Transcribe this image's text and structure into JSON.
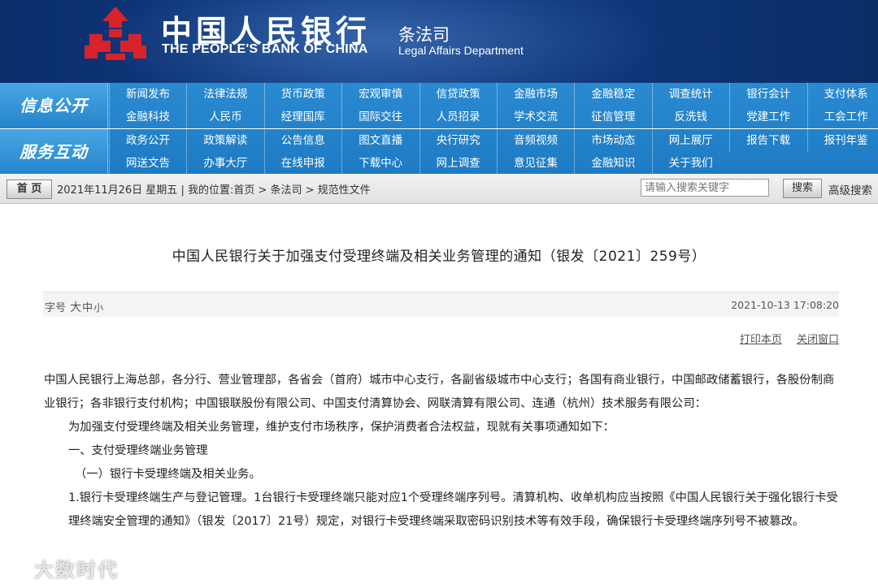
{
  "header": {
    "bank_name_cn": "中国人民银行",
    "bank_name_en": "THE PEOPLE'S BANK OF CHINA",
    "dept_cn": "条法司",
    "dept_en": "Legal Affairs Department"
  },
  "nav": {
    "groups": [
      {
        "title": "信息公开",
        "items": [
          "新闻发布",
          "法律法规",
          "货币政策",
          "宏观审慎",
          "信贷政策",
          "金融市场",
          "金融稳定",
          "调查统计",
          "银行会计",
          "支付体系",
          "金融科技",
          "人民币",
          "经理国库",
          "国际交往",
          "人员招录",
          "学术交流",
          "征信管理",
          "反洗钱",
          "党建工作",
          "工会工作"
        ]
      },
      {
        "title": "服务互动",
        "items": [
          "政务公开",
          "政策解读",
          "公告信息",
          "图文直播",
          "央行研究",
          "音频视频",
          "市场动态",
          "网上展厅",
          "报告下载",
          "报刊年鉴",
          "网送文告",
          "办事大厅",
          "在线申报",
          "下载中心",
          "网上调查",
          "意见征集",
          "金融知识",
          "关于我们"
        ]
      }
    ]
  },
  "toolbar": {
    "home": "首 页",
    "date": "2021年11月26日 星期五",
    "location_prefix": "| 我的位置:",
    "breadcrumb": "首页 > 条法司 > 规范性文件",
    "search_placeholder": "请输入搜索关键字",
    "search_button": "搜索",
    "advanced_search": "高级搜索"
  },
  "article": {
    "title": "中国人民银行关于加强支付受理终端及相关业务管理的通知（银发〔2021〕259号）",
    "font_size_label": "字号",
    "font_sizes": [
      "大",
      "中",
      "小"
    ],
    "timestamp": "2021-10-13 17:08:20",
    "print": "打印本页",
    "close": "关闭窗口",
    "paragraphs": [
      "中国人民银行上海总部，各分行、营业管理部，各省会（首府）城市中心支行，各副省级城市中心支行；各国有商业银行，中国邮政储蓄银行，各股份制商业银行；各非银行支付机构；中国银联股份有限公司、中国支付清算协会、网联清算有限公司、连通（杭州）技术服务有限公司：",
      "为加强支付受理终端及相关业务管理，维护支付市场秩序，保护消费者合法权益，现就有关事项通知如下：",
      "一、支付受理终端业务管理",
      "（一）银行卡受理终端及相关业务。",
      "1.银行卡受理终端生产与登记管理。1台银行卡受理终端只能对应1个受理终端序列号。清算机构、收单机构应当按照《中国人民银行关于强化银行卡受理终端安全管理的通知》（银发〔2017〕21号）规定，对银行卡受理终端采取密码识别技术等有效手段，确保银行卡受理终端序列号不被篡改。"
    ]
  },
  "watermark": {
    "text": "大数时代"
  },
  "colors": {
    "banner": "#0f3679",
    "nav": "#1e7bc4",
    "logo_red": "#d9232a"
  }
}
